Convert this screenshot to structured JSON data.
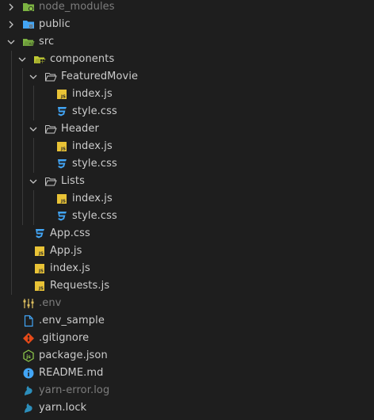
{
  "explorer": {
    "items": [
      {
        "label": "node_modules",
        "type": "folder",
        "depth": 0,
        "chevron": "right",
        "icon": "node-folder-icon",
        "dim": true
      },
      {
        "label": "public",
        "type": "folder",
        "depth": 0,
        "chevron": "right",
        "icon": "public-folder-icon",
        "dim": false
      },
      {
        "label": "src",
        "type": "folder",
        "depth": 0,
        "chevron": "down",
        "icon": "src-folder-icon",
        "dim": false
      },
      {
        "label": "components",
        "type": "folder",
        "depth": 1,
        "chevron": "down",
        "icon": "components-folder-icon",
        "dim": false
      },
      {
        "label": "FeaturedMovie",
        "type": "folder",
        "depth": 2,
        "chevron": "down",
        "icon": "folder-open-icon",
        "dim": false
      },
      {
        "label": "index.js",
        "type": "file",
        "depth": 3,
        "icon": "js-file-icon",
        "dim": false
      },
      {
        "label": "style.css",
        "type": "file",
        "depth": 3,
        "icon": "css-file-icon",
        "dim": false
      },
      {
        "label": "Header",
        "type": "folder",
        "depth": 2,
        "chevron": "down",
        "icon": "folder-open-icon",
        "dim": false
      },
      {
        "label": "index.js",
        "type": "file",
        "depth": 3,
        "icon": "js-file-icon",
        "dim": false
      },
      {
        "label": "style.css",
        "type": "file",
        "depth": 3,
        "icon": "css-file-icon",
        "dim": false
      },
      {
        "label": "Lists",
        "type": "folder",
        "depth": 2,
        "chevron": "down",
        "icon": "folder-open-icon",
        "dim": false
      },
      {
        "label": "index.js",
        "type": "file",
        "depth": 3,
        "icon": "js-file-icon",
        "dim": false
      },
      {
        "label": "style.css",
        "type": "file",
        "depth": 3,
        "icon": "css-file-icon",
        "dim": false
      },
      {
        "label": "App.css",
        "type": "file",
        "depth": 1,
        "icon": "css-file-icon",
        "dim": false
      },
      {
        "label": "App.js",
        "type": "file",
        "depth": 1,
        "icon": "js-file-icon",
        "dim": false
      },
      {
        "label": "index.js",
        "type": "file",
        "depth": 1,
        "icon": "js-file-icon",
        "dim": false
      },
      {
        "label": "Requests.js",
        "type": "file",
        "depth": 1,
        "icon": "js-file-icon",
        "dim": false
      },
      {
        "label": ".env",
        "type": "file",
        "depth": 0,
        "icon": "env-file-icon",
        "dim": true
      },
      {
        "label": ".env_sample",
        "type": "file",
        "depth": 0,
        "icon": "file-icon",
        "dim": false
      },
      {
        "label": ".gitignore",
        "type": "file",
        "depth": 0,
        "icon": "git-icon",
        "dim": false
      },
      {
        "label": "package.json",
        "type": "file",
        "depth": 0,
        "icon": "nodejs-icon",
        "dim": false
      },
      {
        "label": "README.md",
        "type": "file",
        "depth": 0,
        "icon": "info-icon",
        "dim": false
      },
      {
        "label": "yarn-error.log",
        "type": "file",
        "depth": 0,
        "icon": "yarn-icon",
        "dim": true
      },
      {
        "label": "yarn.lock",
        "type": "file",
        "depth": 0,
        "icon": "yarn-icon",
        "dim": false
      }
    ]
  },
  "colors": {
    "background": "#1e1e1e",
    "text": "#cccccc",
    "dimText": "#7d7d7d",
    "jsIcon": "#e9c336",
    "cssIcon": "#42a5f5",
    "gitIcon": "#e64a19",
    "nodeIcon": "#8bc34a",
    "infoIcon": "#42a5f5",
    "yarnIcon": "#2c8ebb",
    "folderGreen": "#7cb342",
    "folderBlue": "#42a5f5",
    "envIcon": "#e0c060"
  }
}
